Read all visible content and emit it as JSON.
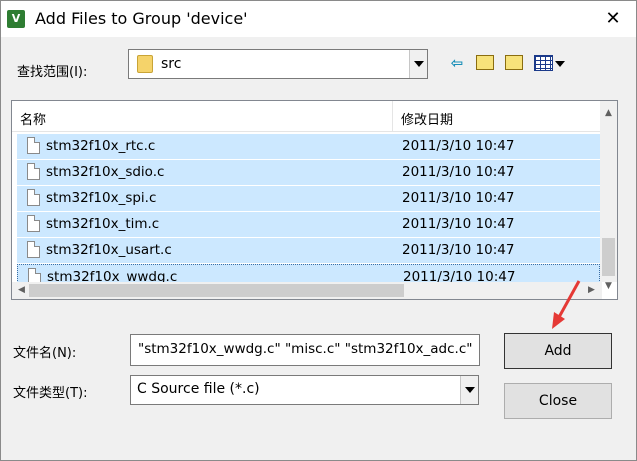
{
  "window": {
    "title": "Add Files to Group 'device'",
    "close_glyph": "✕"
  },
  "lookin": {
    "label": "查找范围(I):",
    "value": "src"
  },
  "list": {
    "columns": {
      "name": "名称",
      "date": "修改日期"
    },
    "rows": [
      {
        "name": "stm32f10x_rtc.c",
        "date": "2011/3/10 10:47"
      },
      {
        "name": "stm32f10x_sdio.c",
        "date": "2011/3/10 10:47"
      },
      {
        "name": "stm32f10x_spi.c",
        "date": "2011/3/10 10:47"
      },
      {
        "name": "stm32f10x_tim.c",
        "date": "2011/3/10 10:47"
      },
      {
        "name": "stm32f10x_usart.c",
        "date": "2011/3/10 10:47"
      },
      {
        "name": "stm32f10x_wwdg.c",
        "date": "2011/3/10 10:47"
      }
    ]
  },
  "form": {
    "filename_label": "文件名(N):",
    "filename_value": "\"stm32f10x_wwdg.c\" \"misc.c\" \"stm32f10x_adc.c\"",
    "filetype_label": "文件类型(T):",
    "filetype_value": "C Source file (*.c)"
  },
  "buttons": {
    "add": "Add",
    "close": "Close"
  },
  "colors": {
    "selection": "#cce8ff",
    "annotation_arrow": "#e53935"
  }
}
